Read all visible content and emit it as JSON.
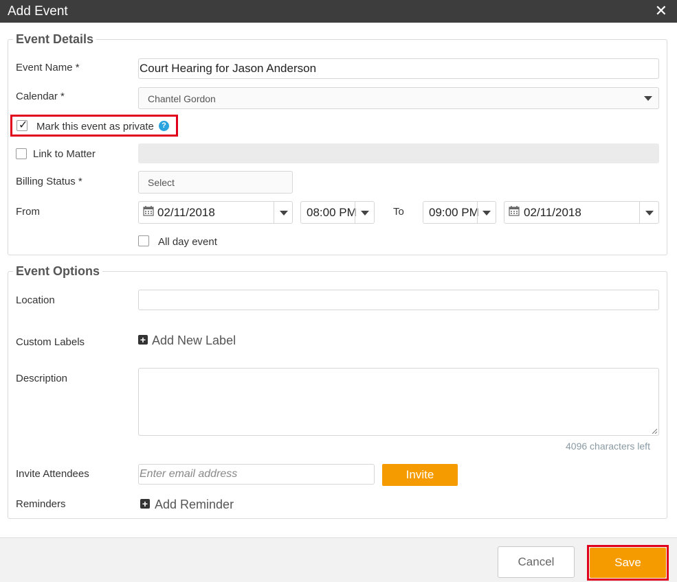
{
  "dialog": {
    "title": "Add Event",
    "close_glyph": "✕"
  },
  "event_details": {
    "legend": "Event Details",
    "event_name": {
      "label": "Event Name *",
      "value": "Court Hearing for Jason Anderson"
    },
    "calendar": {
      "label": "Calendar *",
      "value": "Chantel Gordon"
    },
    "private": {
      "label": "Mark this event as private",
      "checked": true,
      "help_glyph": "?"
    },
    "link_matter": {
      "label": "Link to Matter",
      "checked": false
    },
    "billing_status": {
      "label": "Billing Status *",
      "placeholder": "Select"
    },
    "from": {
      "label": "From",
      "start_date": "02/11/2018",
      "start_time": "08:00 PM",
      "to_label": "To",
      "end_time": "09:00 PM",
      "end_date": "02/11/2018"
    },
    "all_day": {
      "label": "All day event",
      "checked": false
    }
  },
  "event_options": {
    "legend": "Event Options",
    "location": {
      "label": "Location",
      "value": ""
    },
    "custom_labels": {
      "label": "Custom Labels",
      "add_label": "Add New Label"
    },
    "description": {
      "label": "Description",
      "value": "",
      "chars_left": "4096 characters left"
    },
    "invite": {
      "label": "Invite Attendees",
      "placeholder": "Enter email address",
      "button": "Invite"
    },
    "reminders": {
      "label": "Reminders",
      "add_label": "Add Reminder"
    }
  },
  "footer": {
    "cancel": "Cancel",
    "save": "Save"
  },
  "colors": {
    "accent": "#f59b00",
    "highlight": "#e0001b",
    "titlebar": "#3d3d3d",
    "help": "#2aa3df"
  },
  "icons": [
    "close-icon",
    "check-icon",
    "help-icon",
    "chevron-down-icon",
    "calendar-icon",
    "plus-icon",
    "resize-grip-icon"
  ]
}
